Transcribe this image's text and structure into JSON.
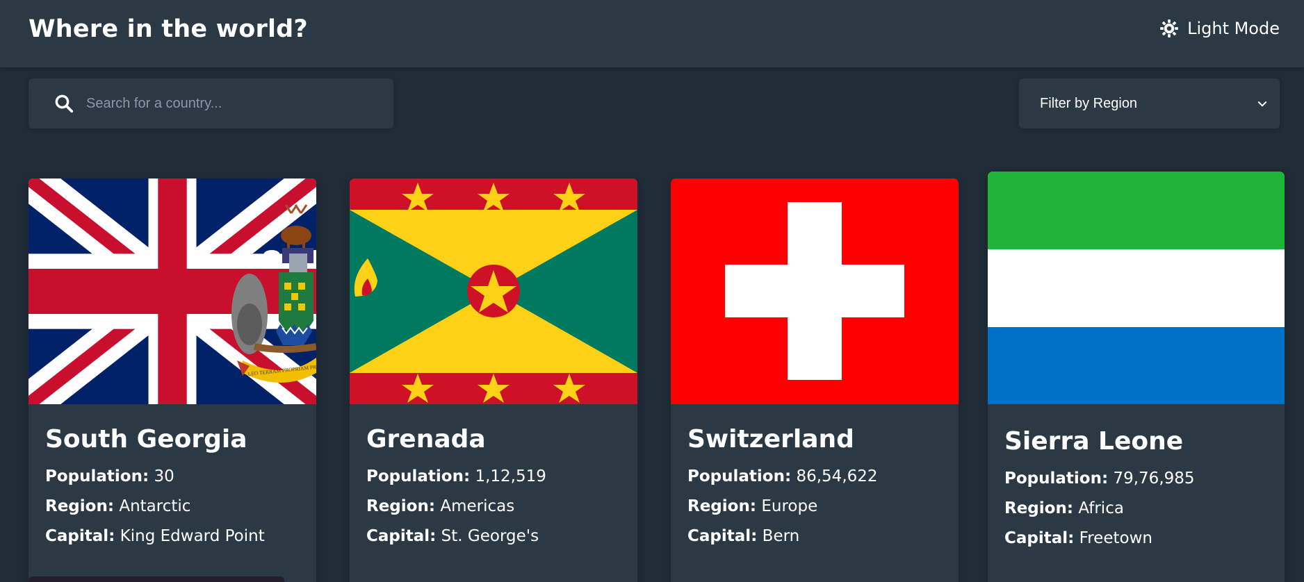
{
  "header": {
    "title": "Where in the world?",
    "mode_label": "Light Mode"
  },
  "search": {
    "placeholder": "Search for a country...",
    "value": ""
  },
  "filter": {
    "label": "Filter by Region"
  },
  "labels": {
    "population": "Population:",
    "region": "Region:",
    "capital": "Capital:"
  },
  "countries": [
    {
      "name": "South Georgia",
      "population": "30",
      "region": "Antarctic",
      "capital": "King Edward Point",
      "flag_motto": "LEO TERRAM PROPRIAM PROTEGAT"
    },
    {
      "name": "Grenada",
      "population": "1,12,519",
      "region": "Americas",
      "capital": "St. George's"
    },
    {
      "name": "Switzerland",
      "population": "86,54,622",
      "region": "Europe",
      "capital": "Bern"
    },
    {
      "name": "Sierra Leone",
      "population": "79,76,985",
      "region": "Africa",
      "capital": "Freetown"
    }
  ],
  "colors": {
    "background": "#202c37",
    "elements": "#2b3945",
    "text": "#ffffff"
  }
}
